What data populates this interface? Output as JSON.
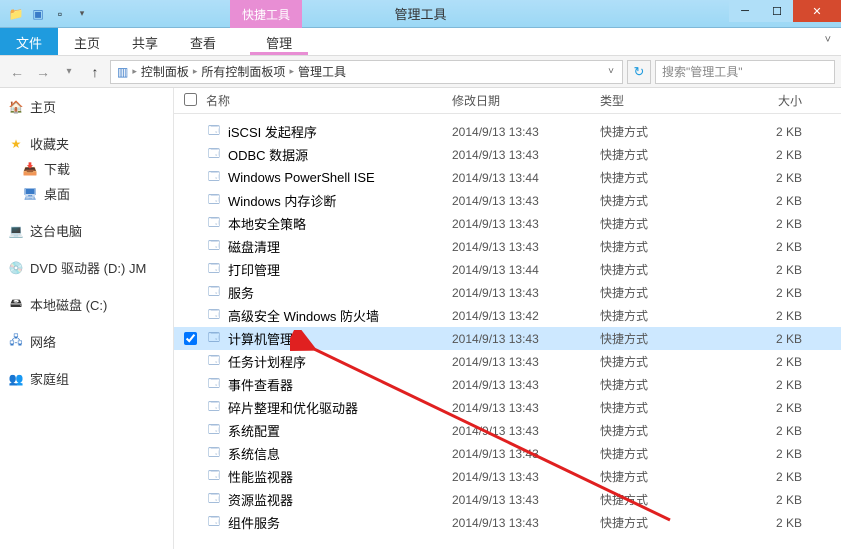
{
  "titlebar": {
    "contextual_group": "快捷工具",
    "window_title": "管理工具"
  },
  "ribbon": {
    "file": "文件",
    "tabs": [
      "主页",
      "共享",
      "查看"
    ],
    "contextual": "管理"
  },
  "navbar": {
    "breadcrumbs": [
      "控制面板",
      "所有控制面板项",
      "管理工具"
    ],
    "search_placeholder": "搜索\"管理工具\""
  },
  "sidebar": {
    "home": "主页",
    "favorites": "收藏夹",
    "downloads": "下载",
    "desktop": "桌面",
    "this_pc": "这台电脑",
    "dvd": "DVD 驱动器 (D:) JM",
    "local_disk": "本地磁盘 (C:)",
    "network": "网络",
    "homegroup": "家庭组"
  },
  "columns": {
    "name": "名称",
    "date": "修改日期",
    "type": "类型",
    "size": "大小"
  },
  "files": [
    {
      "name": "iSCSI 发起程序",
      "date": "2014/9/13 13:43",
      "type": "快捷方式",
      "size": "2 KB",
      "selected": false
    },
    {
      "name": "ODBC 数据源",
      "date": "2014/9/13 13:43",
      "type": "快捷方式",
      "size": "2 KB",
      "selected": false
    },
    {
      "name": "Windows PowerShell ISE",
      "date": "2014/9/13 13:44",
      "type": "快捷方式",
      "size": "2 KB",
      "selected": false
    },
    {
      "name": "Windows 内存诊断",
      "date": "2014/9/13 13:43",
      "type": "快捷方式",
      "size": "2 KB",
      "selected": false
    },
    {
      "name": "本地安全策略",
      "date": "2014/9/13 13:43",
      "type": "快捷方式",
      "size": "2 KB",
      "selected": false
    },
    {
      "name": "磁盘清理",
      "date": "2014/9/13 13:43",
      "type": "快捷方式",
      "size": "2 KB",
      "selected": false
    },
    {
      "name": "打印管理",
      "date": "2014/9/13 13:44",
      "type": "快捷方式",
      "size": "2 KB",
      "selected": false
    },
    {
      "name": "服务",
      "date": "2014/9/13 13:43",
      "type": "快捷方式",
      "size": "2 KB",
      "selected": false
    },
    {
      "name": "高级安全 Windows 防火墙",
      "date": "2014/9/13 13:42",
      "type": "快捷方式",
      "size": "2 KB",
      "selected": false
    },
    {
      "name": "计算机管理",
      "date": "2014/9/13 13:43",
      "type": "快捷方式",
      "size": "2 KB",
      "selected": true
    },
    {
      "name": "任务计划程序",
      "date": "2014/9/13 13:43",
      "type": "快捷方式",
      "size": "2 KB",
      "selected": false
    },
    {
      "name": "事件查看器",
      "date": "2014/9/13 13:43",
      "type": "快捷方式",
      "size": "2 KB",
      "selected": false
    },
    {
      "name": "碎片整理和优化驱动器",
      "date": "2014/9/13 13:43",
      "type": "快捷方式",
      "size": "2 KB",
      "selected": false
    },
    {
      "name": "系统配置",
      "date": "2014/9/13 13:43",
      "type": "快捷方式",
      "size": "2 KB",
      "selected": false
    },
    {
      "name": "系统信息",
      "date": "2014/9/13 13:43",
      "type": "快捷方式",
      "size": "2 KB",
      "selected": false
    },
    {
      "name": "性能监视器",
      "date": "2014/9/13 13:43",
      "type": "快捷方式",
      "size": "2 KB",
      "selected": false
    },
    {
      "name": "资源监视器",
      "date": "2014/9/13 13:43",
      "type": "快捷方式",
      "size": "2 KB",
      "selected": false
    },
    {
      "name": "组件服务",
      "date": "2014/9/13 13:43",
      "type": "快捷方式",
      "size": "2 KB",
      "selected": false
    }
  ]
}
